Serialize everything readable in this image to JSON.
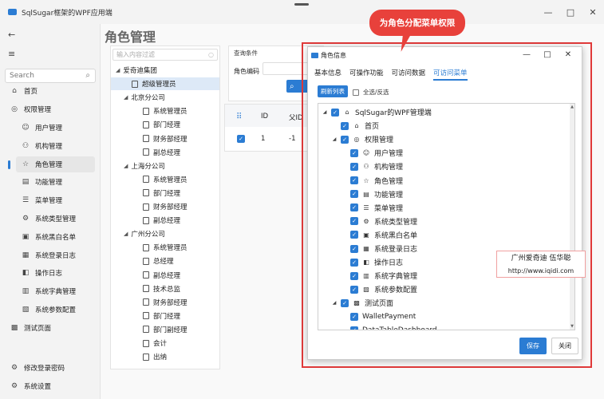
{
  "window": {
    "title": "SqlSugar框架的WPF应用端",
    "controls": [
      "—",
      "□",
      "✕"
    ]
  },
  "sidebar": {
    "search_placeholder": "Search",
    "items": [
      {
        "label": "首页",
        "icon": "home-icon",
        "glyph": "⌂"
      },
      {
        "label": "权限管理",
        "icon": "shield-icon",
        "glyph": "◎"
      },
      {
        "label": "用户管理",
        "icon": "user-icon",
        "glyph": "☺"
      },
      {
        "label": "机构管理",
        "icon": "org-icon",
        "glyph": "⚇"
      },
      {
        "label": "角色管理",
        "icon": "role-icon",
        "glyph": "☆"
      },
      {
        "label": "功能管理",
        "icon": "function-icon",
        "glyph": "▤"
      },
      {
        "label": "菜单管理",
        "icon": "menu-icon",
        "glyph": "☰"
      },
      {
        "label": "系统类型管理",
        "icon": "type-icon",
        "glyph": "⚙"
      },
      {
        "label": "系统黑白名单",
        "icon": "blacklist-icon",
        "glyph": "▣"
      },
      {
        "label": "系统登录日志",
        "icon": "login-log-icon",
        "glyph": "▦"
      },
      {
        "label": "操作日志",
        "icon": "op-log-icon",
        "glyph": "◧"
      },
      {
        "label": "系统字典管理",
        "icon": "dictionary-icon",
        "glyph": "▥"
      },
      {
        "label": "系统参数配置",
        "icon": "params-icon",
        "glyph": "▧"
      },
      {
        "label": "测试页面",
        "icon": "test-icon",
        "glyph": "▩"
      },
      {
        "label": "修改登录密码",
        "icon": "password-icon",
        "glyph": "⚙"
      },
      {
        "label": "系统设置",
        "icon": "settings-icon",
        "glyph": "⚙"
      }
    ]
  },
  "main": {
    "title": "角色管理",
    "org_filter_placeholder": "输入内容过滤",
    "org_tree": [
      {
        "label": "爱奇迪集团",
        "level": 0,
        "type": "group"
      },
      {
        "label": "超级管理员",
        "level": 1,
        "type": "leaf"
      },
      {
        "label": "北京分公司",
        "level": 1,
        "type": "group"
      },
      {
        "label": "系统管理员",
        "level": 2,
        "type": "leaf"
      },
      {
        "label": "部门经理",
        "level": 2,
        "type": "leaf"
      },
      {
        "label": "财务部经理",
        "level": 2,
        "type": "leaf"
      },
      {
        "label": "副总经理",
        "level": 2,
        "type": "leaf"
      },
      {
        "label": "上海分公司",
        "level": 1,
        "type": "group"
      },
      {
        "label": "系统管理员",
        "level": 2,
        "type": "leaf"
      },
      {
        "label": "部门经理",
        "level": 2,
        "type": "leaf"
      },
      {
        "label": "财务部经理",
        "level": 2,
        "type": "leaf"
      },
      {
        "label": "副总经理",
        "level": 2,
        "type": "leaf"
      },
      {
        "label": "广州分公司",
        "level": 1,
        "type": "group"
      },
      {
        "label": "系统管理员",
        "level": 2,
        "type": "leaf"
      },
      {
        "label": "总经理",
        "level": 2,
        "type": "leaf"
      },
      {
        "label": "副总经理",
        "level": 2,
        "type": "leaf"
      },
      {
        "label": "技术总监",
        "level": 2,
        "type": "leaf"
      },
      {
        "label": "财务部经理",
        "level": 2,
        "type": "leaf"
      },
      {
        "label": "部门经理",
        "level": 2,
        "type": "leaf"
      },
      {
        "label": "部门副经理",
        "level": 2,
        "type": "leaf"
      },
      {
        "label": "会计",
        "level": 2,
        "type": "leaf"
      },
      {
        "label": "出纳",
        "level": 2,
        "type": "leaf"
      }
    ],
    "query": {
      "title": "查询条件",
      "role_code_label": "角色编码"
    },
    "grid": {
      "headers": [
        "ID",
        "父ID"
      ],
      "rows": [
        [
          "1",
          "-1"
        ]
      ]
    }
  },
  "dialog": {
    "title": "角色信息",
    "tabs": [
      "基本信息",
      "可操作功能",
      "可访问数据",
      "可访问菜单"
    ],
    "active_tab": 3,
    "refresh_label": "刷新列表",
    "select_all_label": "全选/反选",
    "menu_tree": [
      {
        "label": "SqlSugar的WPF管理端",
        "level": 0,
        "arrow": "◢",
        "icon": "home-icon",
        "glyph": "⌂"
      },
      {
        "label": "首页",
        "level": 1,
        "arrow": "",
        "icon": "home-icon",
        "glyph": "⌂"
      },
      {
        "label": "权限管理",
        "level": 1,
        "arrow": "◢",
        "icon": "shield-icon",
        "glyph": "◎"
      },
      {
        "label": "用户管理",
        "level": 2,
        "arrow": "",
        "icon": "user-icon",
        "glyph": "☺"
      },
      {
        "label": "机构管理",
        "level": 2,
        "arrow": "",
        "icon": "org-icon",
        "glyph": "⚇"
      },
      {
        "label": "角色管理",
        "level": 2,
        "arrow": "",
        "icon": "role-icon",
        "glyph": "☆"
      },
      {
        "label": "功能管理",
        "level": 2,
        "arrow": "",
        "icon": "function-icon",
        "glyph": "▤"
      },
      {
        "label": "菜单管理",
        "level": 2,
        "arrow": "",
        "icon": "menu-icon",
        "glyph": "☰"
      },
      {
        "label": "系统类型管理",
        "level": 2,
        "arrow": "",
        "icon": "type-icon",
        "glyph": "⚙"
      },
      {
        "label": "系统黑白名单",
        "level": 2,
        "arrow": "",
        "icon": "blacklist-icon",
        "glyph": "▣"
      },
      {
        "label": "系统登录日志",
        "level": 2,
        "arrow": "",
        "icon": "login-log-icon",
        "glyph": "▦"
      },
      {
        "label": "操作日志",
        "level": 2,
        "arrow": "",
        "icon": "op-log-icon",
        "glyph": "◧"
      },
      {
        "label": "系统字典管理",
        "level": 2,
        "arrow": "",
        "icon": "dictionary-icon",
        "glyph": "▥"
      },
      {
        "label": "系统参数配置",
        "level": 2,
        "arrow": "",
        "icon": "params-icon",
        "glyph": "▧"
      },
      {
        "label": "测试页面",
        "level": 1,
        "arrow": "◢",
        "icon": "test-icon",
        "glyph": "▩"
      },
      {
        "label": "WalletPayment",
        "level": 2,
        "arrow": "",
        "icon": "",
        "glyph": ""
      },
      {
        "label": "DataTableDashboard",
        "level": 2,
        "arrow": "",
        "icon": "",
        "glyph": ""
      }
    ],
    "save_label": "保存",
    "close_label": "关闭"
  },
  "callout": {
    "text": "为角色分配菜单权限"
  },
  "watermark": {
    "line1": "广州爱奇迪 伍华聪",
    "line2": "http://www.iqidi.com"
  },
  "colors": {
    "accent": "#2b7cd3",
    "highlight_red": "#e03a3a"
  }
}
